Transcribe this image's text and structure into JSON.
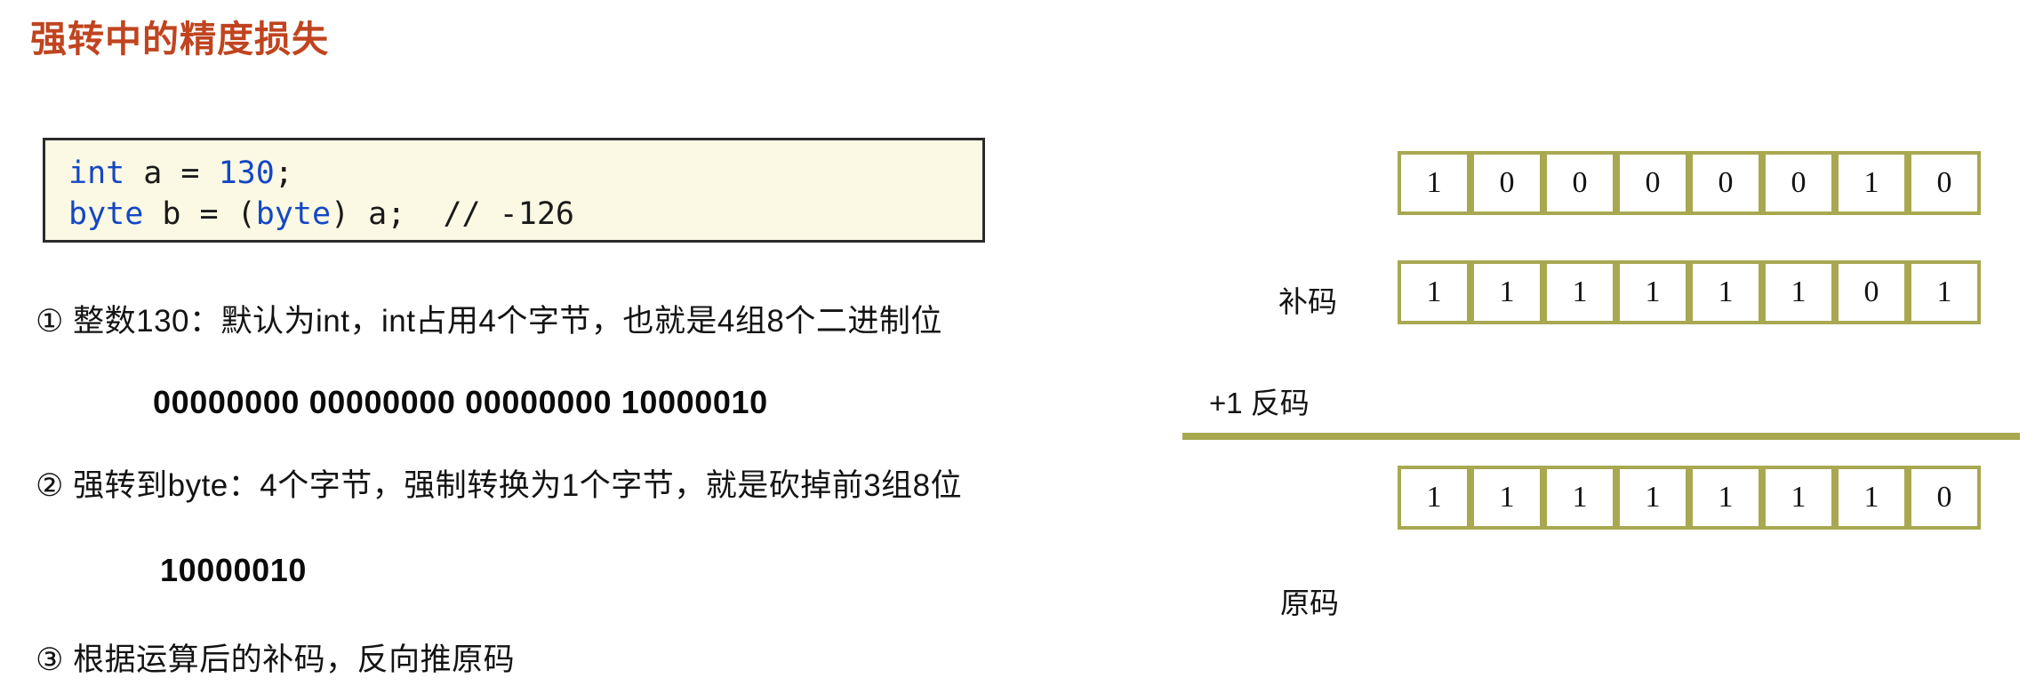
{
  "slide": {
    "title": "强转中的精度损失",
    "title_color": "#c0441f",
    "background": "#ffffff"
  },
  "code_block": {
    "background": "#fbf9e4",
    "border_color": "#2b2b2b",
    "keyword_color": "#1447c4",
    "lines": [
      {
        "tokens": [
          {
            "text": "int",
            "kind": "keyword"
          },
          {
            "text": " a = ",
            "kind": "plain"
          },
          {
            "text": "130",
            "kind": "number"
          },
          {
            "text": ";",
            "kind": "plain"
          }
        ]
      },
      {
        "tokens": [
          {
            "text": "byte",
            "kind": "keyword"
          },
          {
            "text": " b = (",
            "kind": "plain"
          },
          {
            "text": "byte",
            "kind": "keyword"
          },
          {
            "text": ") a;  ",
            "kind": "plain"
          },
          {
            "text": "// -126",
            "kind": "comment"
          }
        ]
      }
    ],
    "line1_kw": "int",
    "line1_mid": " a = ",
    "line1_num": "130",
    "line1_end": ";",
    "line2_kw": "byte",
    "line2_mid": " b = (",
    "line2_kw2": "byte",
    "line2_mid2": ") a;  ",
    "line2_comment": "// -126"
  },
  "explanations": [
    {
      "id": "step-1",
      "text": "① 整数130：默认为int，int占用4个字节，也就是4组8个二进制位",
      "binary": "00000000 00000000 00000000 10000010"
    },
    {
      "id": "step-2",
      "text": "② 强转到byte：4个字节，强制转换为1个字节，就是砍掉前3组8位",
      "binary": "10000010"
    },
    {
      "id": "step-3",
      "text": "③ 根据运算后的补码，反向推原码",
      "binary": ""
    }
  ],
  "bit_diagram": {
    "accent_color": "#a8a851",
    "cell_background": "#ffffff",
    "rows": [
      {
        "name": "truncated-byte",
        "label": "",
        "bits": [
          "1",
          "0",
          "0",
          "0",
          "0",
          "0",
          "1",
          "0"
        ]
      },
      {
        "name": "complement",
        "label": "补码",
        "bits": [
          "1",
          "1",
          "1",
          "1",
          "1",
          "1",
          "0",
          "1"
        ]
      },
      {
        "name": "original",
        "label": "原码",
        "bits": [
          "1",
          "1",
          "1",
          "1",
          "1",
          "1",
          "1",
          "0"
        ]
      }
    ],
    "plus_one_label": "+1 反码",
    "complement_label": "补码",
    "original_label": "原码"
  }
}
